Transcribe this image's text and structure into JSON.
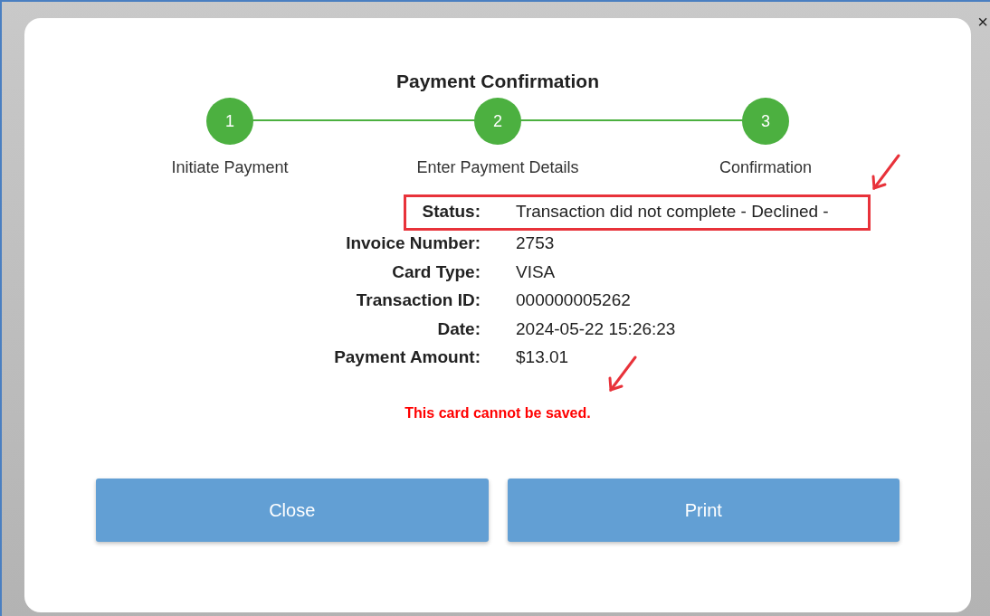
{
  "dialog": {
    "title": "Payment Confirmation",
    "close_glyph": "×"
  },
  "steps": [
    {
      "number": "1",
      "label": "Initiate Payment",
      "completed": true
    },
    {
      "number": "2",
      "label": "Enter Payment Details",
      "completed": true
    },
    {
      "number": "3",
      "label": "Confirmation",
      "completed": true
    }
  ],
  "details": [
    {
      "label": "Status:",
      "value": "Transaction did not complete - Declined -",
      "highlighted": true
    },
    {
      "label": "Invoice Number:",
      "value": "2753",
      "highlighted": false
    },
    {
      "label": "Card Type:",
      "value": "VISA",
      "highlighted": false
    },
    {
      "label": "Transaction ID:",
      "value": "000000005262",
      "highlighted": false
    },
    {
      "label": "Date:",
      "value": "2024-05-22 15:26:23",
      "highlighted": false
    },
    {
      "label": "Payment Amount:",
      "value": "$13.01",
      "highlighted": false
    }
  ],
  "message": {
    "text": "This card cannot be saved.",
    "flagged": true
  },
  "buttons": [
    {
      "label": "Close"
    },
    {
      "label": "Print"
    }
  ]
}
